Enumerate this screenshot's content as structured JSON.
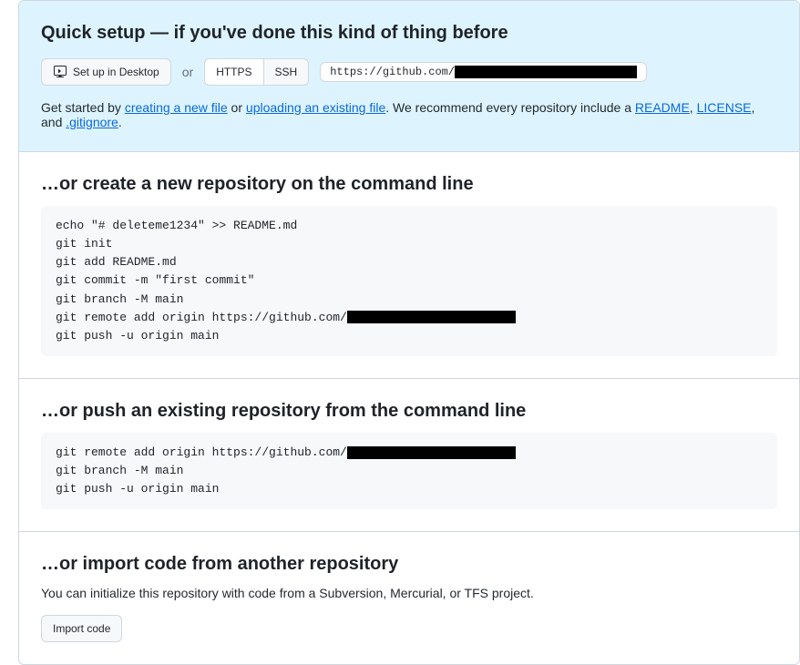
{
  "quick_setup": {
    "heading": "Quick setup — if you've done this kind of thing before",
    "desktop_button": "Set up in Desktop",
    "or_text": "or",
    "https_button": "HTTPS",
    "ssh_button": "SSH",
    "url_prefix": "https://github.com/",
    "help_prefix": "Get started by ",
    "link_new_file": "creating a new file",
    "help_or": " or ",
    "link_upload": "uploading an existing file",
    "help_mid": ". We recommend every repository include a ",
    "link_readme": "README",
    "help_comma": ", ",
    "link_license": "LICENSE",
    "help_and": ", and ",
    "link_gitignore": ".gitignore",
    "help_period": "."
  },
  "create_section": {
    "heading": "…or create a new repository on the command line",
    "lines": {
      "l0": "echo \"# deleteme1234\" >> README.md",
      "l1": "git init",
      "l2": "git add README.md",
      "l3": "git commit -m \"first commit\"",
      "l4": "git branch -M main",
      "l5_prefix": "git remote add origin https://github.com/",
      "l6": "git push -u origin main"
    }
  },
  "push_section": {
    "heading": "…or push an existing repository from the command line",
    "lines": {
      "l0_prefix": "git remote add origin https://github.com/",
      "l1": "git branch -M main",
      "l2": "git push -u origin main"
    }
  },
  "import_section": {
    "heading": "…or import code from another repository",
    "description": "You can initialize this repository with code from a Subversion, Mercurial, or TFS project.",
    "button": "Import code"
  }
}
